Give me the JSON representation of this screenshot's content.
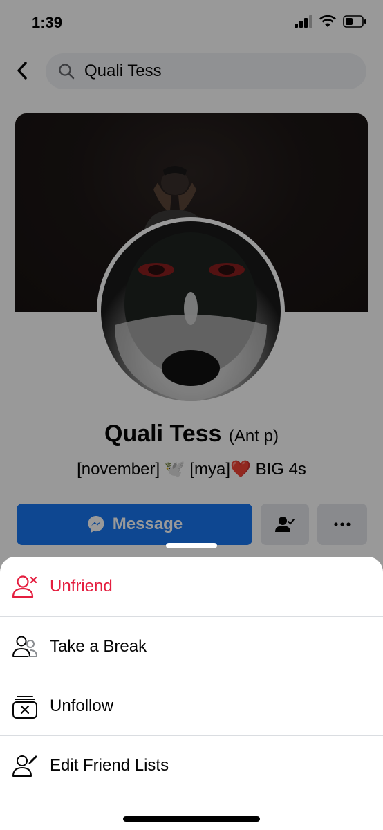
{
  "status_bar": {
    "time": "1:39"
  },
  "header": {
    "search_value": "Quali Tess"
  },
  "profile": {
    "name": "Quali Tess",
    "alternate_name": "(Ant p)",
    "bio": "[november] 🕊️   [mya]❤️ BIG 4s"
  },
  "actions": {
    "message_label": "Message"
  },
  "sheet": {
    "items": [
      {
        "label": "Unfriend",
        "icon": "unfriend-icon",
        "color": "#e41e3f"
      },
      {
        "label": "Take a Break",
        "icon": "take-a-break-icon",
        "color": "#050505"
      },
      {
        "label": "Unfollow",
        "icon": "unfollow-icon",
        "color": "#050505"
      },
      {
        "label": "Edit Friend Lists",
        "icon": "edit-friend-lists-icon",
        "color": "#050505"
      }
    ]
  },
  "colors": {
    "accent": "#1877f2",
    "danger": "#e41e3f"
  }
}
